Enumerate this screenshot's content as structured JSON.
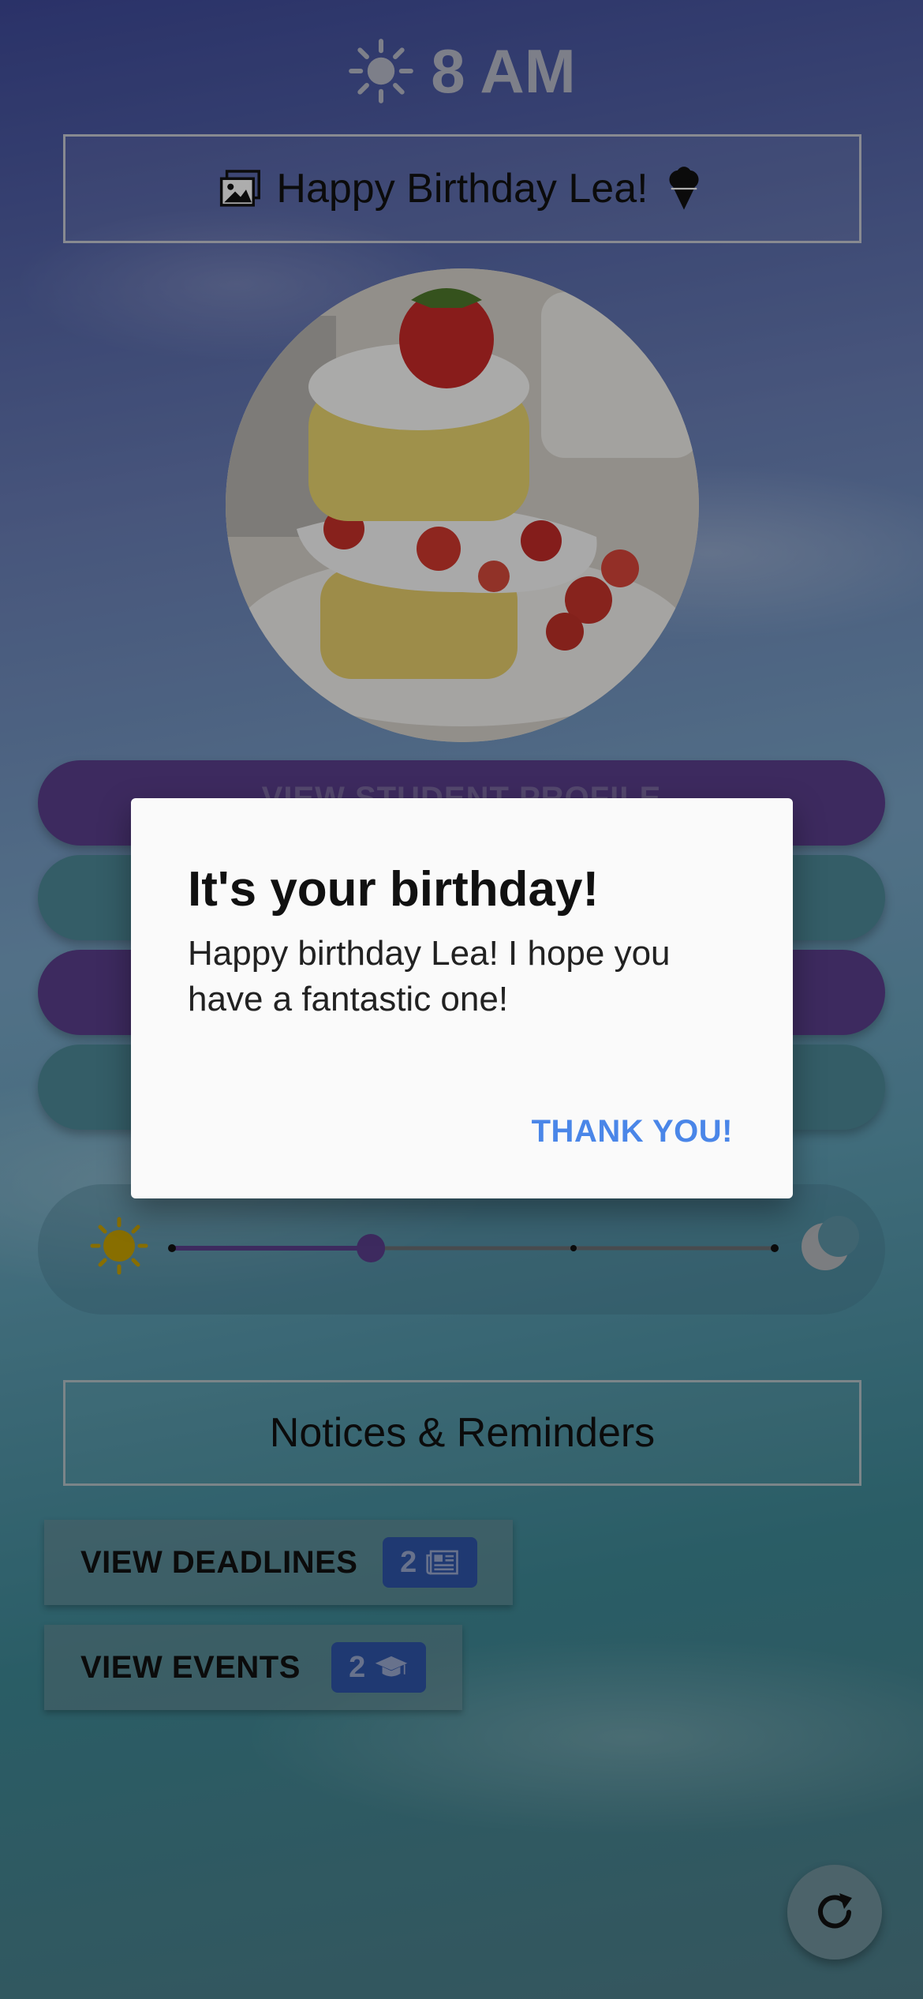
{
  "status": {
    "time": "8 AM"
  },
  "header": {
    "title": "Happy Birthday Lea!"
  },
  "menu": {
    "first_label": "VIEW STUDENT PROFILE"
  },
  "slider": {
    "level": 0.33
  },
  "notices": {
    "title": "Notices & Reminders",
    "deadlines_label": "VIEW DEADLINES",
    "deadlines_count": "2",
    "events_label": "VIEW EVENTS",
    "events_count": "2"
  },
  "dialog": {
    "title": "It's your birthday!",
    "message": "Happy birthday Lea! I hope you have a fantastic one!",
    "action": "THANK YOU!"
  },
  "colors": {
    "purple_button": "#5a3f8c",
    "teal_button": "#4d8a98",
    "badge": "#2f55a8",
    "dialog_action": "#4a86e8",
    "sun": "#c9a200"
  },
  "icons": [
    "sun-icon",
    "images-icon",
    "ice-cream-icon",
    "moon-icon",
    "newspaper-icon",
    "graduation-cap-icon",
    "refresh-icon"
  ]
}
